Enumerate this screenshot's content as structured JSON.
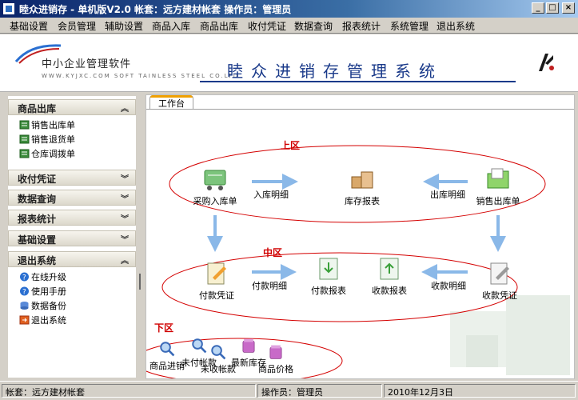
{
  "window": {
    "title": "睦众进销存 - 单机版V2.0 帐套：远方建材帐套 操作员：管理员",
    "buttons": {
      "minimize": "_",
      "maximize": "□",
      "close": "×"
    }
  },
  "menu": [
    "基础设置",
    "会员管理",
    "辅助设置",
    "商品入库",
    "商品出库",
    "收付凭证",
    "数据查询",
    "报表统计",
    "系统管理",
    "退出系统"
  ],
  "banner": {
    "company": "中小企业管理软件",
    "company_en": "WWW.KYJXC.COM SOFT TAINLESS STEEL CO.LTD",
    "system_name": "睦众进销存管理系统"
  },
  "sidebar": {
    "groups": [
      {
        "label": "商品出库",
        "chevron": "︽",
        "items": [
          "销售出库单",
          "销售退货单",
          "仓库调拨单"
        ]
      },
      {
        "label": "收付凭证",
        "chevron": "︾"
      },
      {
        "label": "数据查询",
        "chevron": "︾"
      },
      {
        "label": "报表统计",
        "chevron": "︾"
      },
      {
        "label": "基础设置",
        "chevron": "︾"
      },
      {
        "label": "退出系统",
        "chevron": "︽",
        "items": [
          "在线升级",
          "使用手册",
          "数据备份",
          "退出系统"
        ]
      }
    ]
  },
  "workspace": {
    "tab": "工作台",
    "zones": {
      "upper": "上区",
      "middle": "中区",
      "lower": "下区"
    },
    "upper": {
      "nodes": [
        "采购入库单",
        "库存报表",
        "销售出库单"
      ],
      "flows": [
        "入库明细",
        "出库明细"
      ]
    },
    "middle": {
      "nodes": [
        "付款凭证",
        "付款报表",
        "收款报表",
        "收款凭证"
      ],
      "flows": [
        "付款明细",
        "收款明细"
      ]
    },
    "lower": {
      "nodes": [
        "商品进销",
        "未付帐款",
        "未收帐款",
        "最新库存",
        "商品价格"
      ]
    }
  },
  "status": {
    "account": "帐套：远方建材帐套",
    "operator": "操作员：管理员",
    "date": "2010年12月3日"
  },
  "colors": {
    "zone_ellipse": "#d40000",
    "arrow": "#8ab8e8",
    "title_bar": "#0a246a"
  }
}
